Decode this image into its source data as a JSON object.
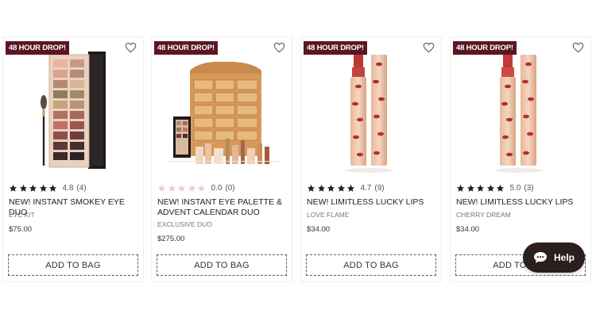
{
  "products": [
    {
      "badge": "48 HOUR DROP!",
      "rating_value": "4.8",
      "review_count": "(4)",
      "stars_filled": 5,
      "name": "NEW! INSTANT SMOKEY EYE DUO",
      "variant": "EYE KIT",
      "price": "$75.00",
      "button_label": "ADD TO BAG",
      "image": "eyeshadow-palette-with-brush"
    },
    {
      "badge": "48 HOUR DROP!",
      "rating_value": "0.0",
      "review_count": "(0)",
      "stars_filled": 0,
      "name": "NEW! INSTANT EYE PALETTE & ADVENT CALENDAR DUO",
      "variant": "EXCLUSIVE DUO",
      "price": "$275.00",
      "button_label": "ADD TO BAG",
      "image": "advent-calendar-gift-set"
    },
    {
      "badge": "48 HOUR DROP!",
      "rating_value": "4.7",
      "review_count": "(9)",
      "stars_filled": 5,
      "name": "NEW! LIMITLESS LUCKY LIPS",
      "variant": "LOVE FLAME",
      "price": "$34.00",
      "button_label": "ADD TO BAG",
      "image": "lipstick-pair"
    },
    {
      "badge": "48 HOUR DROP!",
      "rating_value": "5.0",
      "review_count": "(3)",
      "stars_filled": 5,
      "name": "NEW! LIMITLESS LUCKY LIPS",
      "variant": "CHERRY DREAM",
      "price": "$34.00",
      "button_label": "ADD TO BAG",
      "image": "lipstick-pair"
    }
  ],
  "help_widget": {
    "label": "Help",
    "icon": "chat-bubble-icon"
  },
  "colors": {
    "badge_bg": "#5a1622",
    "star_filled": "#2b1b1b",
    "star_empty": "#e7cfcf",
    "heart": "#6b6b6b"
  }
}
